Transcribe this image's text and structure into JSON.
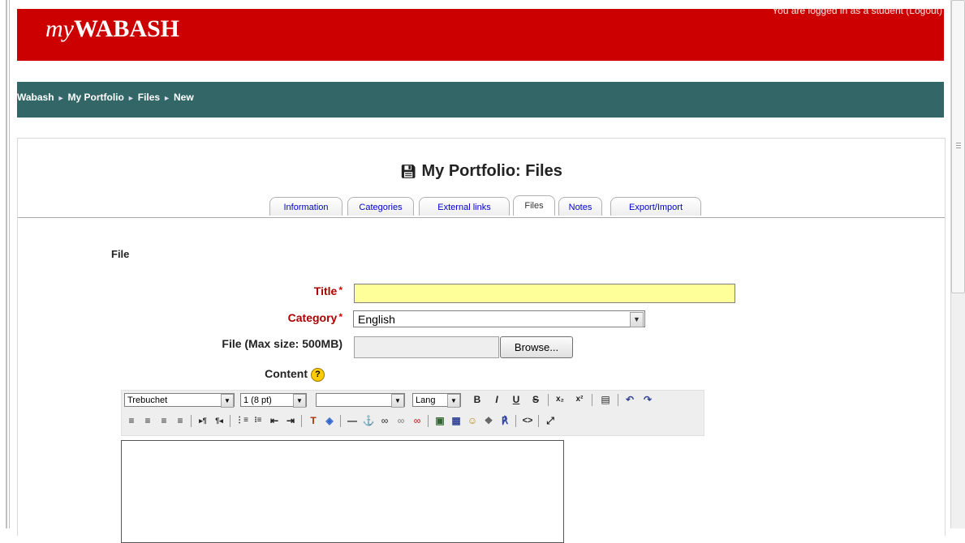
{
  "header": {
    "logo_prefix": "my",
    "logo_main": "WABASH",
    "login_info": "You are logged in as a student (Logout)",
    "brand_color": "#cc0000"
  },
  "breadcrumb": {
    "items": [
      "Wabash",
      "My Portfolio",
      "Files",
      "New"
    ],
    "separator": "►"
  },
  "page": {
    "title": "My Portfolio: Files",
    "title_icon": "floppy-disk-icon"
  },
  "tabs": [
    {
      "label": "Information",
      "active": false
    },
    {
      "label": "Categories",
      "active": false
    },
    {
      "label": "External links",
      "active": false
    },
    {
      "label": "Files",
      "active": true
    },
    {
      "label": "Notes",
      "active": false
    },
    {
      "label": "Export/Import",
      "active": false
    }
  ],
  "form": {
    "section_label": "File",
    "title_label": "Title",
    "title_value": "",
    "required_marker": "*",
    "category_label": "Category",
    "category_value": "English",
    "file_label": "File (Max size: 500MB)",
    "file_value": "",
    "browse_label": "Browse...",
    "content_label": "Content",
    "help_icon": "?"
  },
  "editor_toolbar": {
    "font": "Trebuchet",
    "size": "1 (8 pt)",
    "style": "",
    "lang": "Lang",
    "row1_buttons": [
      "B",
      "I",
      "U",
      "S",
      "x₂",
      "x²",
      "▤",
      "↶",
      "↷"
    ],
    "row2_buttons": [
      "≡",
      "≡",
      "≡",
      "≡",
      "▸¶",
      "¶◂",
      "⋮≡",
      "⁝≡",
      "⇤",
      "⇥",
      "T",
      "◈",
      "—",
      "⚓",
      "∞",
      "∞",
      "∞",
      "▣",
      "▦",
      "☺",
      "❖",
      "℟",
      "<>",
      "⤢"
    ]
  }
}
